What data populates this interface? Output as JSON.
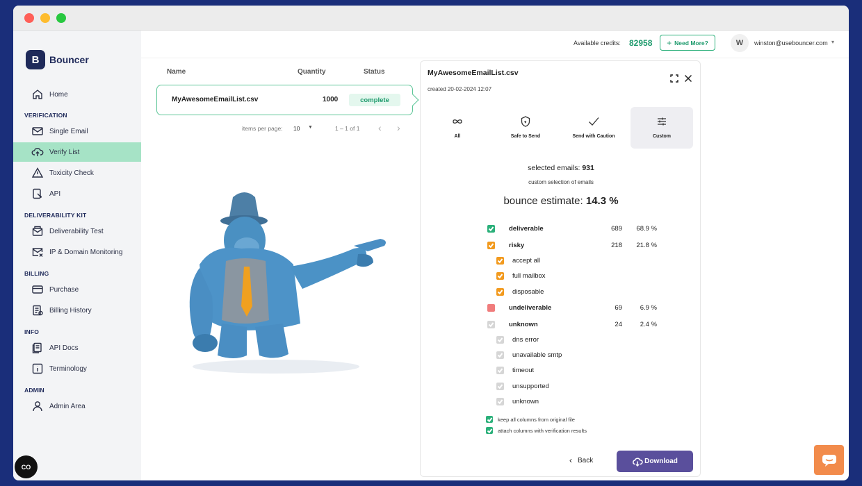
{
  "app": {
    "name": "Bouncer",
    "logo_letter": "B"
  },
  "sidebar": {
    "home": "Home",
    "sections": {
      "verification": "VERIFICATION",
      "deliverability": "DELIVERABILITY KIT",
      "billing": "BILLING",
      "info": "INFO",
      "admin": "ADMIN"
    },
    "items": {
      "single_email": "Single Email",
      "verify_list": "Verify List",
      "toxicity_check": "Toxicity Check",
      "api": "API",
      "deliverability_test": "Deliverability Test",
      "ip_domain_monitoring": "IP & Domain Monitoring",
      "purchase": "Purchase",
      "billing_history": "Billing History",
      "api_docs": "API Docs",
      "terminology": "Terminology",
      "admin_area": "Admin Area"
    },
    "active_item": "verify_list"
  },
  "topbar": {
    "credits_label": "Available credits:",
    "credits_value": "82958",
    "need_more_label": "Need More?",
    "avatar_letter": "W",
    "user_email": "winston@usebouncer.com"
  },
  "list": {
    "headers": {
      "name": "Name",
      "quantity": "Quantity",
      "status": "Status"
    },
    "file": {
      "name": "MyAwesomeEmailList.csv",
      "quantity": "1000",
      "status": "complete"
    },
    "pager": {
      "items_per_page_label": "items per page:",
      "items_per_page_value": "10",
      "range": "1 – 1 of 1"
    }
  },
  "panel": {
    "title": "MyAwesomeEmailList.csv",
    "created": "created 20-02-2024 12:07",
    "tabs": {
      "all": "All",
      "safe": "Safe to Send",
      "caution": "Send with Caution",
      "custom": "Custom"
    },
    "active_tab": "custom",
    "selected_label": "selected emails:",
    "selected_value": "931",
    "custom_selection": "custom selection of emails",
    "bounce_label": "bounce estimate:",
    "bounce_value": "14.3 %",
    "categories": {
      "deliverable": {
        "label": "deliverable",
        "count": "689",
        "pct": "68.9 %"
      },
      "risky": {
        "label": "risky",
        "count": "218",
        "pct": "21.8 %"
      },
      "accept_all": "accept all",
      "full_mailbox": "full mailbox",
      "disposable": "disposable",
      "undeliverable": {
        "label": "undeliverable",
        "count": "69",
        "pct": "6.9 %"
      },
      "unknown": {
        "label": "unknown",
        "count": "24",
        "pct": "2.4 %"
      },
      "dns_error": "dns error",
      "unavailable_smtp": "unavailable smtp",
      "timeout": "timeout",
      "unsupported": "unsupported",
      "unknown_sub": "unknown"
    },
    "options": {
      "keep_columns": "keep all columns from original file",
      "attach_columns": "attach columns with verification results"
    },
    "back_label": "Back",
    "download_label": "Download"
  },
  "colors": {
    "brand": "#1f2a5a",
    "accent_green": "#1d9a6c",
    "deliverable": "#2bb07a",
    "risky": "#f29a1e",
    "undeliverable": "#f07c7c",
    "unknown": "#d6d6d6",
    "download": "#5a4f9c",
    "chat": "#f28b4b"
  },
  "widgets": {
    "cookie_label": "CO"
  }
}
